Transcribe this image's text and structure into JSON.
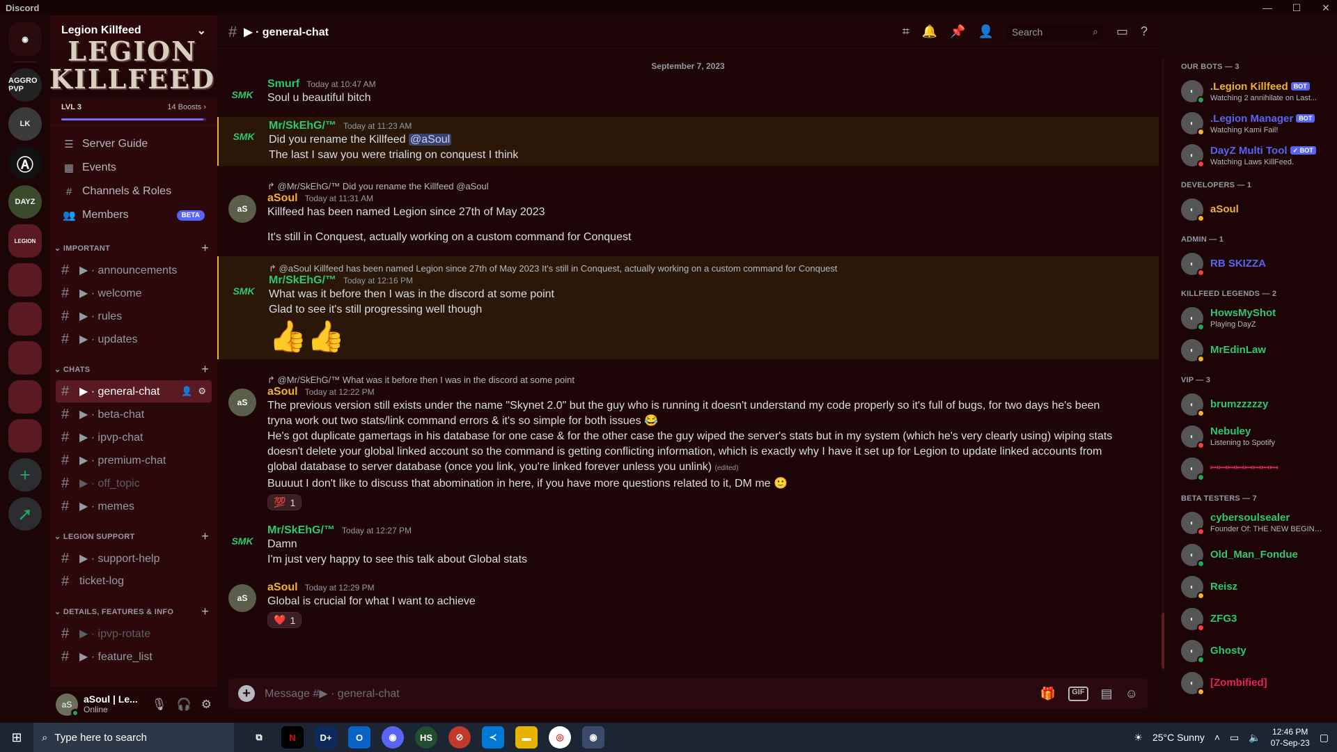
{
  "window": {
    "app_title": "Discord"
  },
  "server": {
    "name": "Legion Killfeed",
    "banner_logo": "LEGION KILLFEED",
    "level": "LVL 3",
    "boosts": "14 Boosts",
    "boost_progress": 0.98
  },
  "rail": {
    "servers": [
      "AGGRO PVP",
      "LK",
      "Ⓐ",
      "DAYZ",
      "LEGION",
      "",
      "",
      "",
      "",
      ""
    ]
  },
  "nav": [
    {
      "label": "Server Guide",
      "icon": "server-guide-icon"
    },
    {
      "label": "Events",
      "icon": "calendar-icon"
    },
    {
      "label": "Channels & Roles",
      "icon": "channels-roles-icon"
    },
    {
      "label": "Members",
      "icon": "members-icon",
      "badge": "BETA"
    }
  ],
  "categories": [
    {
      "name": "IMPORTANT",
      "channels": [
        {
          "label": "▶ · announcements"
        },
        {
          "label": "▶ · welcome"
        },
        {
          "label": "▶ · rules"
        },
        {
          "label": "▶ · updates"
        }
      ]
    },
    {
      "name": "CHATS",
      "channels": [
        {
          "label": "▶ · general-chat",
          "active": true
        },
        {
          "label": "▶ · beta-chat"
        },
        {
          "label": "▶ · ipvp-chat"
        },
        {
          "label": "▶ · premium-chat"
        },
        {
          "label": "▶ · off_topic",
          "muted": true
        },
        {
          "label": "▶ · memes"
        }
      ]
    },
    {
      "name": "LEGION SUPPORT",
      "channels": [
        {
          "label": "▶ · support-help"
        },
        {
          "label": "ticket-log"
        }
      ]
    },
    {
      "name": "DETAILS, FEATURES & INFO",
      "channels": [
        {
          "label": "▶ · ipvp-rotate",
          "muted": true
        },
        {
          "label": "▶ · feature_list"
        }
      ]
    }
  ],
  "user": {
    "name": "aSoul | Le...",
    "status": "Online"
  },
  "header": {
    "channel": "▶ · general-chat",
    "search_placeholder": "Search"
  },
  "date_divider": "September 7, 2023",
  "messages": [
    {
      "author": "Smurf",
      "color": "#2dc770",
      "time": "Today at 10:47 AM",
      "lines": [
        "Soul u beautiful bitch"
      ]
    },
    {
      "author": "Mr/SkEhG/™",
      "color": "#2dc770",
      "time": "Today at 11:23 AM",
      "highlight": true,
      "lines": [
        "Did you rename the Killfeed",
        "The last I saw you were trialing on conquest I think"
      ],
      "mention": "@aSoul"
    },
    {
      "reply": "@Mr/SkEhG/™ Did you rename the Killfeed @aSoul",
      "author": "aSoul",
      "color": "#f0b232",
      "time": "Today at 11:31 AM",
      "lines": [
        "Killfeed has been named Legion since 27th of May 2023",
        "",
        "It's still in Conquest, actually working on a custom command for Conquest"
      ]
    },
    {
      "reply": "@aSoul Killfeed has been named Legion since 27th of May 2023 It's still in Conquest, actually working on a custom command for Conquest",
      "author": "Mr/SkEhG/™",
      "color": "#2dc770",
      "time": "Today at 12:16 PM",
      "highlight": true,
      "lines": [
        "What was it before then I was in the discord at some point",
        "Glad to see it's still progressing well though"
      ],
      "emoji": "👍👍"
    },
    {
      "reply": "@Mr/SkEhG/™ What was it before then I was in the discord at some point",
      "author": "aSoul",
      "color": "#f0b232",
      "time": "Today at 12:22 PM",
      "lines": [
        "The previous version still exists under the name \"Skynet 2.0\" but the guy who is running it doesn't understand my code properly so it's full of bugs, for two days he's been tryna work out two stats/link command errors & it's so simple for both issues 😂",
        "He's got duplicate gamertags in his database for one case & for the other case the guy wiped the server's stats but in my system (which he's very clearly using) wiping stats doesn't delete your global linked account so the command is getting conflicting information, which is exactly why I have it set up for Legion to update linked accounts from global database to server database (once you link, you're linked forever unless you unlink)",
        "Buuuut I don't like to discuss that abomination in here, if you have more questions related to it, DM me 🙂"
      ],
      "edited": "(edited)",
      "reaction": {
        "emoji": "💯",
        "count": "1"
      }
    },
    {
      "author": "Mr/SkEhG/™",
      "color": "#2dc770",
      "time": "Today at 12:27 PM",
      "lines": [
        "Damn",
        "I'm just very happy to see this talk about Global stats"
      ]
    },
    {
      "author": "aSoul",
      "color": "#f0b232",
      "time": "Today at 12:29 PM",
      "lines": [
        "Global is crucial for what I want to achieve"
      ],
      "reaction": {
        "emoji": "❤️",
        "count": "1"
      }
    }
  ],
  "composer": {
    "placeholder": "Message #▶ · general-chat",
    "gif_label": "GIF"
  },
  "members": [
    {
      "category": "OUR BOTS — 3",
      "items": [
        {
          "name": ".Legion Killfeed",
          "color": "#f0b232",
          "bot": "BOT",
          "status": "Watching 2 annihilate on Last..."
        },
        {
          "name": ".Legion Manager",
          "color": "#5865f2",
          "bot": "BOT",
          "status": "Watching Kami Fail!"
        },
        {
          "name": "DayZ Multi Tool",
          "color": "#5865f2",
          "bot": "✓ BOT",
          "status": "Watching Laws KillFeed."
        }
      ]
    },
    {
      "category": "DEVELOPERS — 1",
      "items": [
        {
          "name": "aSoul",
          "color": "#f0b232",
          "status": ""
        }
      ]
    },
    {
      "category": "ADMIN — 1",
      "items": [
        {
          "name": "RB SKIZZA",
          "color": "#5865f2",
          "status": ""
        }
      ]
    },
    {
      "category": "KILLFEED LEGENDS — 2",
      "items": [
        {
          "name": "HowsMyShot",
          "color": "#2dc770",
          "status": "Playing DayZ"
        },
        {
          "name": "MrEdinLaw",
          "color": "#2dc770",
          "status": ""
        }
      ]
    },
    {
      "category": "VIP — 3",
      "items": [
        {
          "name": "brumzzzzzy",
          "color": "#2dc770",
          "status": ""
        },
        {
          "name": "Nebuley",
          "color": "#2dc770",
          "status": "Listening to Spotify"
        },
        {
          "name": "ꟷꟷꟷꟷꟷꟷꟷꟷ",
          "color": "#e91e63",
          "status": ""
        }
      ]
    },
    {
      "category": "BETA TESTERS — 7",
      "items": [
        {
          "name": "cybersoulsealer",
          "color": "#2dc770",
          "status": "Founder Of: THE NEW BEGINNI..."
        },
        {
          "name": "Old_Man_Fondue",
          "color": "#2dc770",
          "status": ""
        },
        {
          "name": "Reisz",
          "color": "#2dc770",
          "status": ""
        },
        {
          "name": "ZFG3",
          "color": "#2dc770",
          "status": ""
        },
        {
          "name": "Ghosty",
          "color": "#2dc770",
          "status": ""
        },
        {
          "name": "[Zombified]",
          "color": "#e91e63",
          "status": ""
        }
      ]
    }
  ],
  "taskbar": {
    "search": "Type here to search",
    "weather": "25°C  Sunny",
    "time": "12:46 PM",
    "date": "07-Sep-23"
  }
}
